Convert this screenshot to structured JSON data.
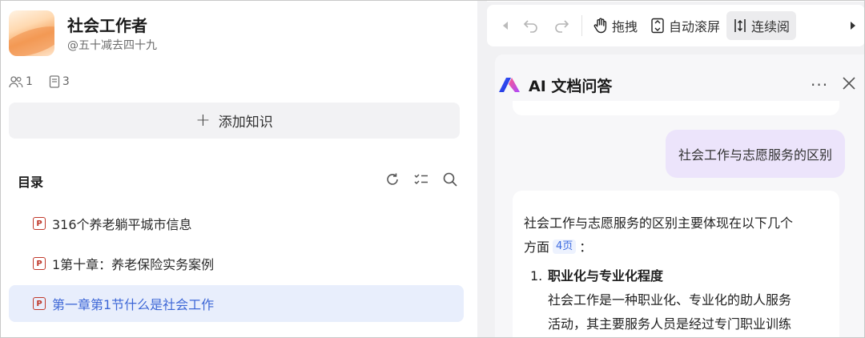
{
  "kb": {
    "title": "社会工作者",
    "subtitle": "@五十减去四十九",
    "members": "1",
    "docs": "3",
    "add_label": "添加知识"
  },
  "toc": {
    "title": "目录",
    "items": [
      {
        "label": "316个养老躺平城市信息",
        "active": false
      },
      {
        "label": "1第十章：养老保险实务案例",
        "active": false
      },
      {
        "label": "第一章第1节什么是社会工作",
        "active": true
      }
    ]
  },
  "toolbar": {
    "drag_label": "拖拽",
    "autoscroll_label": "自动滚屏",
    "continuous_label": "连续阅"
  },
  "ai": {
    "title": "AI 文档问答",
    "dots": "···",
    "user_question": "社会工作与志愿服务的区别",
    "answer_intro_1": "社会工作与志愿服务的区别主要体现在以下几个",
    "answer_intro_2": "方面",
    "answer_cite": "4页",
    "answer_colon": "：",
    "point_num": "1.",
    "point_title": "职业化与专业化程度",
    "point_body_1": "社会工作是一种职业化、专业化的助人服务",
    "point_body_2": "活动，其主要服务人员是经过专门职业训练"
  },
  "colors": {
    "accent": "#3c66d6",
    "active_bg": "#e8eefc",
    "user_bubble": "#ece4fb",
    "pdf_red": "#c0392b"
  }
}
